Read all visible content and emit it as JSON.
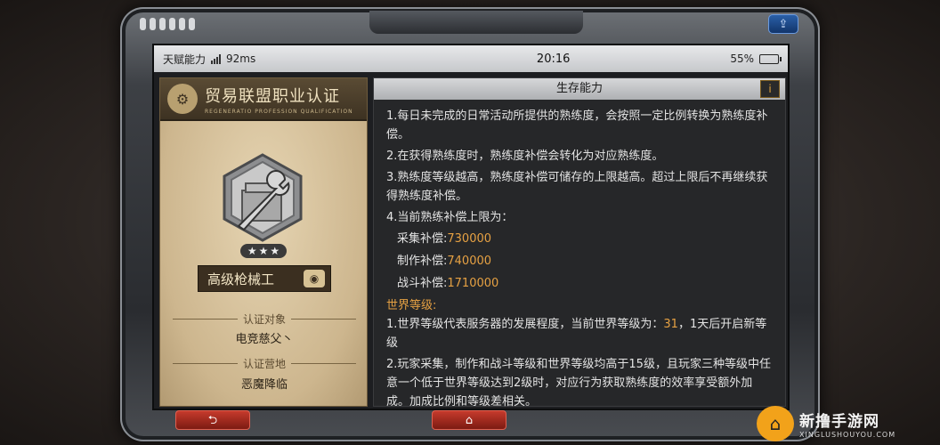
{
  "statusbar": {
    "app_label": "天赋能力",
    "ping": "92ms",
    "time": "20:16",
    "battery_percent": "55%",
    "battery_level": 0.55
  },
  "certificate": {
    "title": "贸易联盟职业认证",
    "subtitle": "REGENERATIO PROFESSION QUALIFICATION",
    "stars": 3,
    "rank_name": "高级枪械工",
    "target_label": "认证对象",
    "target_value": "电竞慈父丶",
    "camp_label": "认证营地",
    "camp_value": "恶魔降临"
  },
  "info_panel": {
    "header": "生存能力",
    "info_button": "i",
    "paragraphs": [
      "1.每日未完成的日常活动所提供的熟练度，会按照一定比例转换为熟练度补偿。",
      "2.在获得熟练度时，熟练度补偿会转化为对应熟练度。",
      "3.熟练度等级越高，熟练度补偿可储存的上限越高。超过上限后不再继续获得熟练度补偿。",
      "4.当前熟练补偿上限为："
    ],
    "caps": [
      {
        "label": "采集补偿:",
        "value": "730000"
      },
      {
        "label": "制作补偿:",
        "value": "740000"
      },
      {
        "label": "战斗补偿:",
        "value": "1710000"
      }
    ],
    "world_title": "世界等级:",
    "world_p1_a": "1.世界等级代表服务器的发展程度，当前世界等级为：",
    "world_p1_level": "31",
    "world_p1_b": "，1天后开启新等级",
    "world_p2": "2.玩家采集，制作和战斗等级和世界等级均高于15级，且玩家三种等级中任意一个低于世界等级达到2级时，对应行为获取熟练度的效率享受额外加成。加成比例和等级差相关。"
  },
  "buttons": {
    "back": "⮌",
    "home": "⌂",
    "top_right": "⇪"
  },
  "watermark": {
    "main": "新撸手游网",
    "sub": "XINGLUSHOUYOU.COM"
  },
  "colors": {
    "accent_orange": "#e6a143",
    "button_red": "#c53a2c"
  }
}
